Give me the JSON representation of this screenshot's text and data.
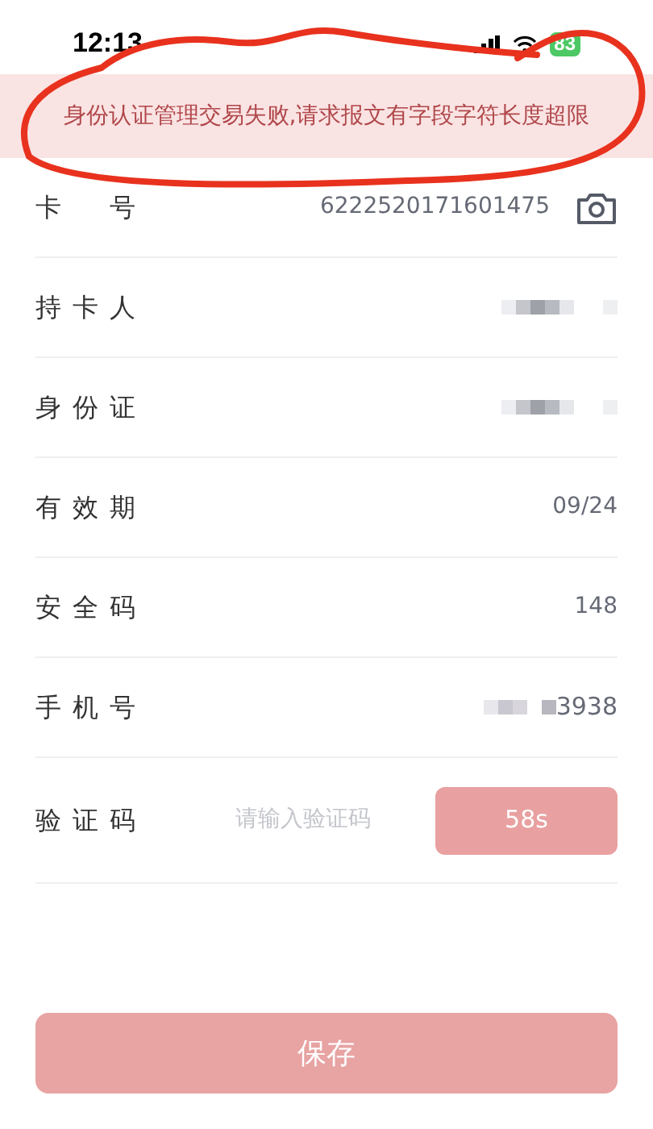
{
  "status_bar": {
    "time": "12:13",
    "battery": "83"
  },
  "error_banner": {
    "text": "身份认证管理交易失败,请求报文有字段字符长度超限"
  },
  "fields": [
    {
      "kind": "text",
      "label": "卡号",
      "value": "6222520171601475",
      "camera": true
    },
    {
      "kind": "redacted",
      "label": "持卡人"
    },
    {
      "kind": "redacted",
      "label": "身份证"
    },
    {
      "kind": "text",
      "label": "有效期",
      "value": "09/24"
    },
    {
      "kind": "text",
      "label": "安全码",
      "value": "148"
    },
    {
      "kind": "partly_redacted",
      "label": "手机号",
      "value": "3938"
    },
    {
      "kind": "code",
      "label": "验证码",
      "placeholder": "请输入验证码",
      "button": "58s"
    }
  ],
  "save_button": {
    "label": "保存"
  }
}
